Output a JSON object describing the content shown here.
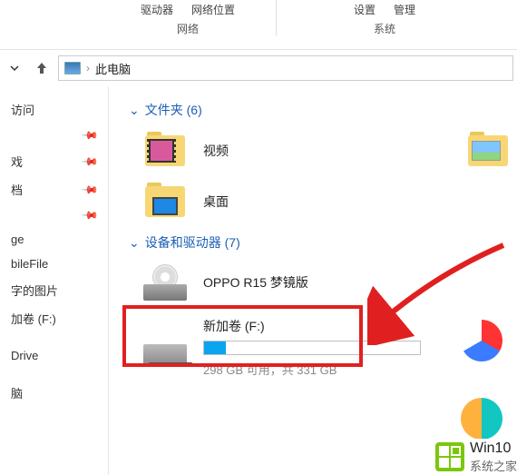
{
  "ribbon": {
    "g1a": "驱动器",
    "g1b": "网络位置",
    "g1label": "网络",
    "g2a": "设置",
    "g2b": "管理",
    "g2label": "系统"
  },
  "address": {
    "crumb": "此电脑"
  },
  "sidebar": {
    "items": [
      {
        "label": "访问"
      },
      {
        "label": ""
      },
      {
        "label": "戏"
      },
      {
        "label": "档"
      },
      {
        "label": ""
      },
      {
        "label": "ge"
      },
      {
        "label": "bileFile"
      },
      {
        "label": "字的图片"
      },
      {
        "label": "加卷 (F:)"
      },
      {
        "label": ""
      },
      {
        "label": "Drive"
      },
      {
        "label": ""
      },
      {
        "label": "脑"
      }
    ]
  },
  "groups": {
    "folders": {
      "label": "文件夹 (6)"
    },
    "drives": {
      "label": "设备和驱动器 (7)"
    }
  },
  "folders": {
    "video": "视频",
    "desktop": "桌面"
  },
  "drives": {
    "oppo": {
      "label": "OPPO R15 梦镜版"
    },
    "volf": {
      "label": "新加卷 (F:)",
      "stats": "298 GB 可用，共 331 GB"
    }
  },
  "watermark": {
    "brand": "Win10",
    "site": "系统之家"
  }
}
